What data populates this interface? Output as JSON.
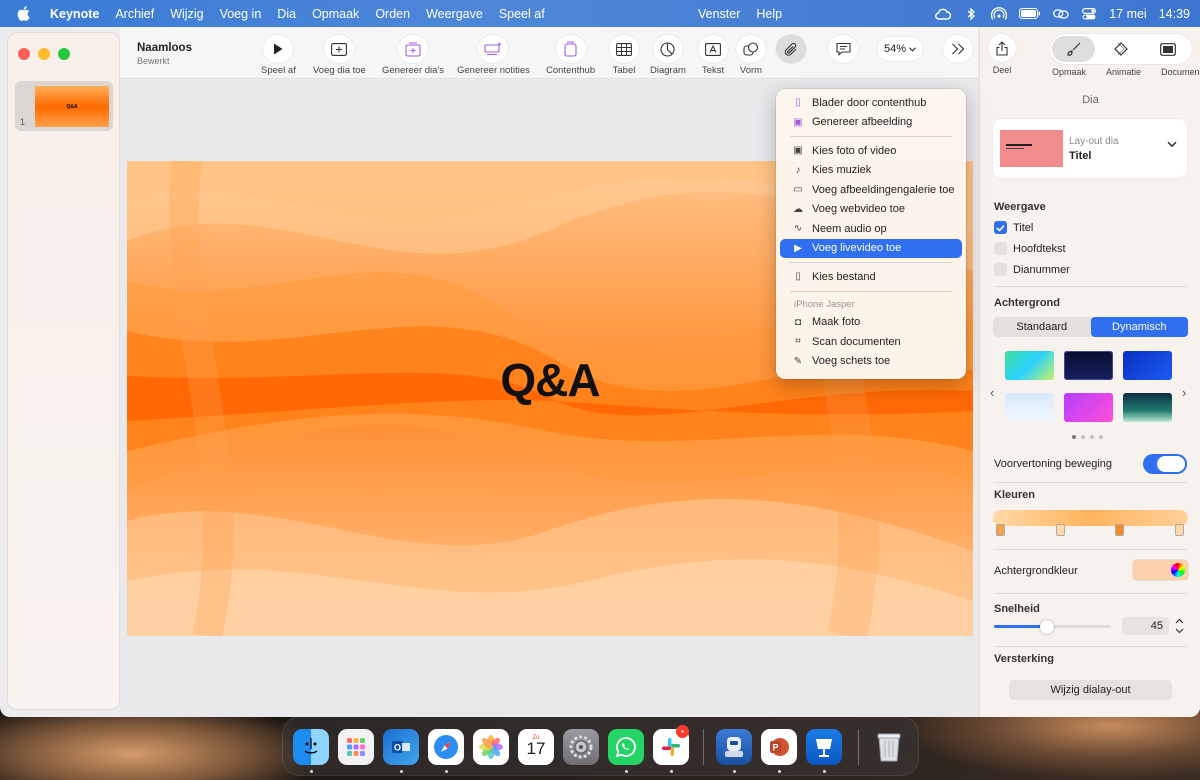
{
  "menubar": {
    "app": "Keynote",
    "items": [
      "Archief",
      "Wijzig",
      "Voeg in",
      "Dia",
      "Opmaak",
      "Orden",
      "Weergave",
      "Speel af"
    ],
    "center_items": [
      "Venster",
      "Help"
    ],
    "date": "17 mei",
    "time": "14:39"
  },
  "document": {
    "title": "Naamloos",
    "subtitle": "Bewerkt"
  },
  "navigator": {
    "slide_number": "1",
    "thumb_text": "Q&A"
  },
  "toolbar": {
    "play": "Speel af",
    "add_slide": "Voeg dia toe",
    "generate_slides": "Genereer dia's",
    "generate_notes": "Genereer notities",
    "contenthub": "Contenthub",
    "table": "Tabel",
    "chart": "Diagram",
    "text": "Tekst",
    "shape": "Vorm",
    "zoom": "54%"
  },
  "slide": {
    "title": "Q&A"
  },
  "dropdown": {
    "items_top": [
      "Blader door contenthub",
      "Genereer afbeelding"
    ],
    "items_media": [
      "Kies foto of video",
      "Kies muziek",
      "Voeg afbeeldingengalerie toe",
      "Voeg webvideo toe",
      "Neem audio op",
      "Voeg livevideo toe"
    ],
    "item_file": "Kies bestand",
    "device_header": "iPhone Jasper",
    "items_device": [
      "Maak foto",
      "Scan documenten",
      "Voeg schets toe"
    ]
  },
  "inspector": {
    "share": "Deel",
    "tabs": [
      "Opmaak",
      "Animatie",
      "Document"
    ],
    "section": "Dia",
    "layout_label": "Lay-out dia",
    "layout_value": "Titel",
    "view_header": "Weergave",
    "view_options": [
      {
        "label": "Titel",
        "checked": true
      },
      {
        "label": "Hoofdtekst",
        "checked": false
      },
      {
        "label": "Dianummer",
        "checked": false
      }
    ],
    "background_header": "Achtergrond",
    "bg_modes": [
      "Standaard",
      "Dynamisch"
    ],
    "motion_preview": "Voorvertoning beweging",
    "colors_header": "Kleuren",
    "bg_color_label": "Achtergrondkleur",
    "speed_header": "Snelheid",
    "speed_value": "45",
    "speed_fraction": 0.45,
    "amplify_header": "Versterking",
    "change_layout": "Wijzig dialay-out"
  },
  "colors": {
    "accent": "#2f6ff0",
    "slide_orange": "#ff7a00"
  }
}
